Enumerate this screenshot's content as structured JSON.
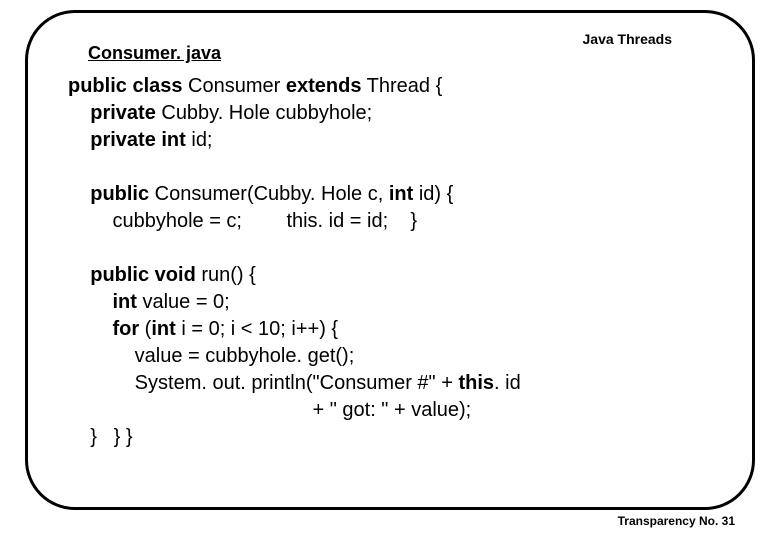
{
  "header": {
    "topic": "Java Threads",
    "title": "Consumer. java"
  },
  "code": {
    "l1a": "public class",
    "l1b": " Consumer ",
    "l1c": "extends",
    "l1d": " Thread {",
    "l2a": "    private",
    "l2b": " Cubby. Hole cubbyhole;",
    "l3a": "    private int",
    "l3b": " id;",
    "blank1": "",
    "l4a": "    public",
    "l4b": " Consumer(Cubby. Hole c, ",
    "l4c": "int",
    "l4d": " id) {",
    "l5": "        cubbyhole = c;        this. id = id;    }",
    "blank2": "",
    "l6a": "    public void",
    "l6b": " run() {",
    "l7a": "        int",
    "l7b": " value = 0;",
    "l8a": "        for",
    "l8b": " (",
    "l8c": "int",
    "l8d": " i = 0; i < 10; i++) {",
    "l9": "            value = cubbyhole. get();",
    "l10a": "            System. out. println(\"Consumer #\" + ",
    "l10b": "this",
    "l10c": ". id",
    "l11": "                                            + \" got: \" + value);",
    "l12": "    }   } }"
  },
  "footer": {
    "label": "Transparency No. 31"
  }
}
